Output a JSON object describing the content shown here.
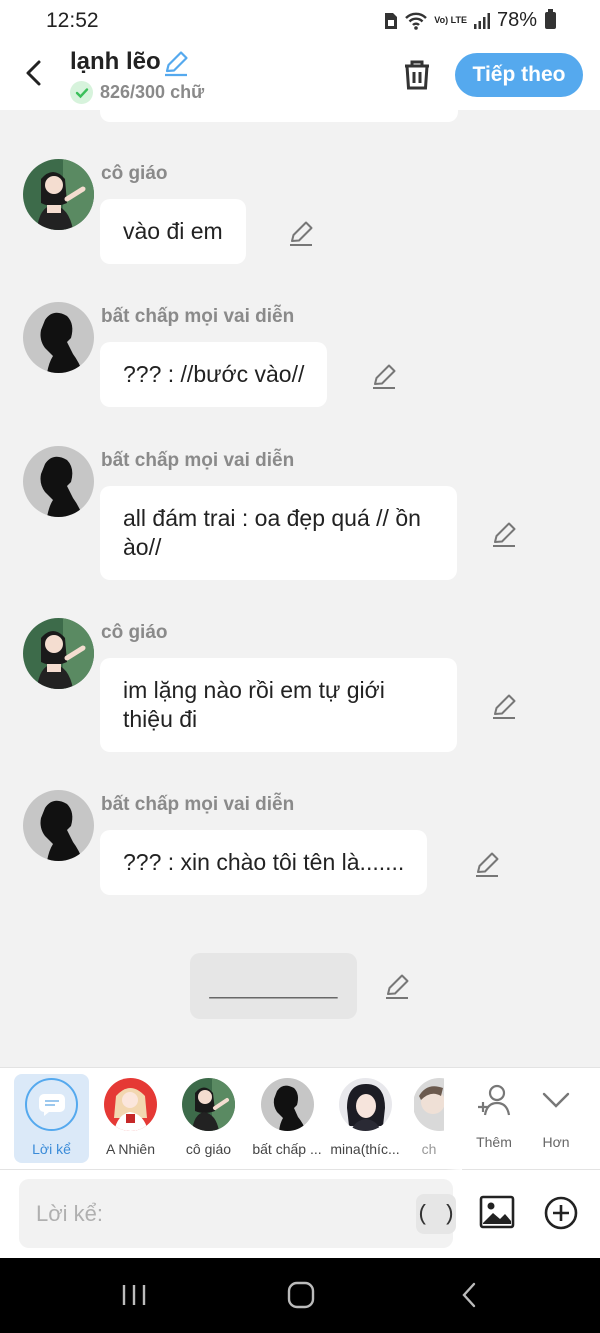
{
  "status_bar": {
    "time": "12:52",
    "network": "Vo) LTE",
    "battery": "78%"
  },
  "header": {
    "title": "lạnh lẽo",
    "count": "826/300 chữ",
    "next_label": "Tiếp theo",
    "accent": "#55a9ee"
  },
  "messages": [
    {
      "speaker": "cô giáo",
      "text": "vào đi em",
      "avatar": "teacher"
    },
    {
      "speaker": "bất chấp mọi vai diễn",
      "text": "??? : //bước vào//",
      "avatar": "silhouette"
    },
    {
      "speaker": "bất chấp mọi vai diễn",
      "text": "all đám trai : oa đẹp quá // ồn ào//",
      "avatar": "silhouette"
    },
    {
      "speaker": "cô giáo",
      "text": "im lặng nào rồi em tự giới thiệu đi",
      "avatar": "teacher"
    },
    {
      "speaker": "bất chấp mọi vai diễn",
      "text": "??? : xin chào tôi tên là.......",
      "avatar": "silhouette"
    }
  ],
  "narration_placeholder": "__________",
  "characters": [
    {
      "label": "Lời kể",
      "icon": "narration-icon",
      "selected": true
    },
    {
      "label": "A Nhiên",
      "icon": "red-hair-avatar"
    },
    {
      "label": "cô giáo",
      "icon": "teacher-avatar"
    },
    {
      "label": "bất chấp ...",
      "icon": "silhouette-avatar"
    },
    {
      "label": "mina(thíc...",
      "icon": "dark-hair-avatar"
    },
    {
      "label": "ch",
      "icon": "partial-avatar"
    }
  ],
  "actions": {
    "more_label": "Thêm",
    "less_label": "Hơn"
  },
  "input": {
    "placeholder": "Lời kể:",
    "paren_label": "( )"
  }
}
